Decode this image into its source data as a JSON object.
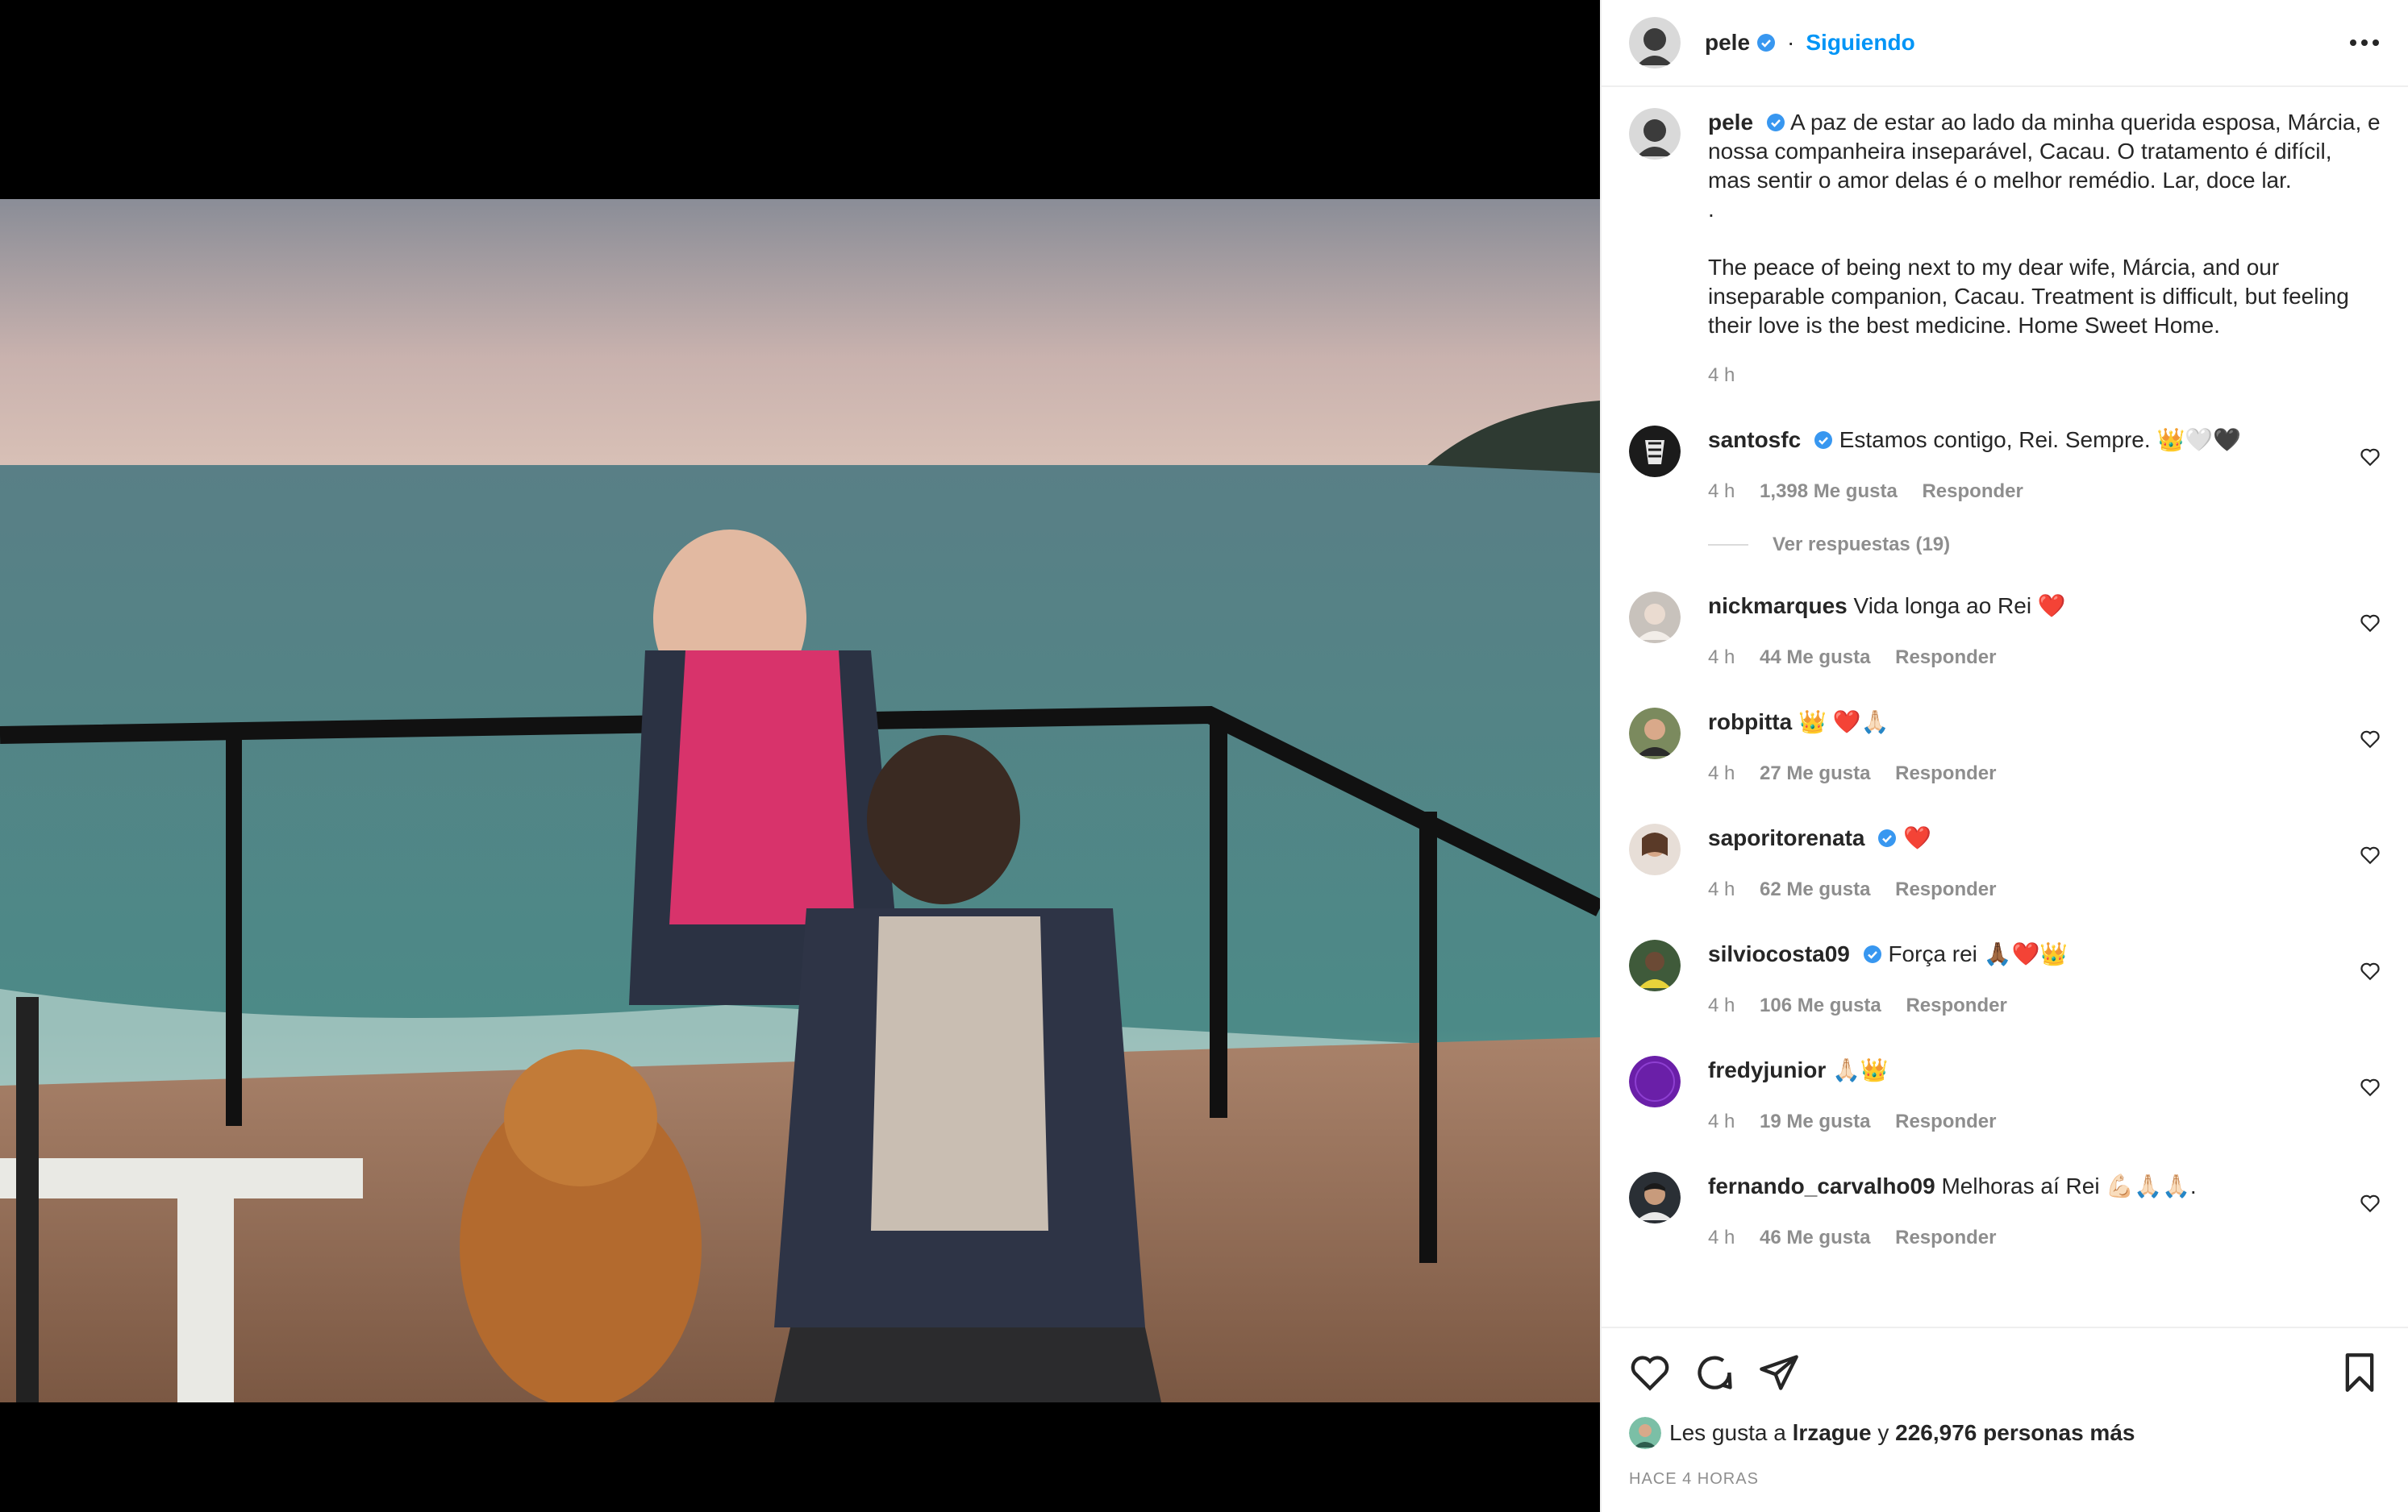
{
  "post": {
    "author": "pele",
    "follow_state": "Siguiendo",
    "separator": "·"
  },
  "caption": {
    "author": "pele",
    "text_pt": "A paz de estar ao lado da minha querida esposa, Márcia, e nossa companheira inseparável, Cacau. O tratamento é difícil, mas sentir o amor delas é o melhor remédio. Lar, doce lar.",
    "dot": ".",
    "text_en": "The peace of being next to my dear wife, Márcia, and our inseparable companion, Cacau. Treatment is difficult, but feeling their love is the best medicine. Home Sweet Home.",
    "time": "4 h"
  },
  "comments": [
    {
      "user": "santosfc",
      "verified": true,
      "text": "Estamos contigo, Rei. Sempre. 👑🤍🖤",
      "time": "4 h",
      "likes": "1,398 Me gusta",
      "reply": "Responder",
      "replies": "Ver respuestas (19)"
    },
    {
      "user": "nickmarques",
      "verified": false,
      "text": "Vida longa ao Rei ❤️",
      "time": "4 h",
      "likes": "44 Me gusta",
      "reply": "Responder"
    },
    {
      "user": "robpitta",
      "verified": false,
      "text": "👑 ❤️🙏🏻",
      "time": "4 h",
      "likes": "27 Me gusta",
      "reply": "Responder"
    },
    {
      "user": "saporitorenata",
      "verified": true,
      "text": "❤️",
      "time": "4 h",
      "likes": "62 Me gusta",
      "reply": "Responder"
    },
    {
      "user": "silviocosta09",
      "verified": true,
      "text": "Força rei 🙏🏾❤️👑",
      "time": "4 h",
      "likes": "106 Me gusta",
      "reply": "Responder"
    },
    {
      "user": "fredyjunior",
      "verified": false,
      "text": "🙏🏻👑",
      "time": "4 h",
      "likes": "19 Me gusta",
      "reply": "Responder"
    },
    {
      "user": "fernando_carvalho09",
      "verified": false,
      "text": "Melhoras aí Rei 💪🏻🙏🏻🙏🏻.",
      "time": "4 h",
      "likes": "46 Me gusta",
      "reply": "Responder"
    }
  ],
  "likes_line": {
    "prefix": "Les gusta a",
    "user": "lrzague",
    "connector": "y",
    "count": "226,976 personas más"
  },
  "posted_ago": "HACE 4 HORAS",
  "icons": {
    "header_more": "more-horizontal-icon",
    "like": "heart-icon",
    "comment": "comment-icon",
    "share": "share-icon",
    "save": "bookmark-icon"
  },
  "colors": {
    "accent": "#0095f6",
    "muted": "#8e8e8e",
    "verified": "#3897f0"
  }
}
